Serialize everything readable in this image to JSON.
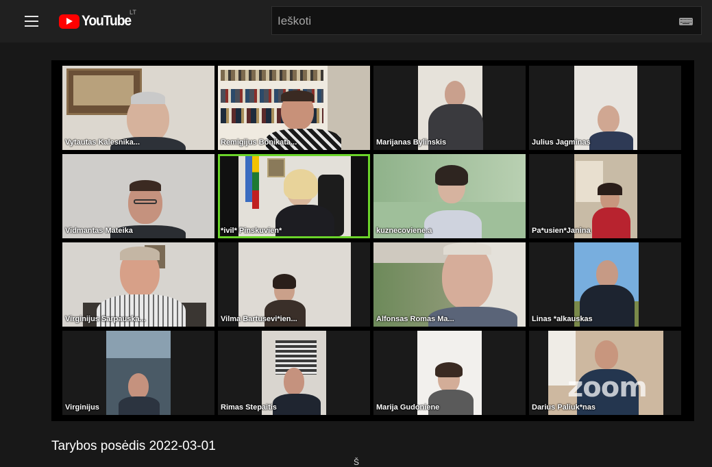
{
  "header": {
    "logo_text": "YouTube",
    "country_code": "LT",
    "search_placeholder": "Ieškoti"
  },
  "participants": [
    {
      "name": "Vytautas Kalesnika..."
    },
    {
      "name": "Remigijus Bonikata..."
    },
    {
      "name": "Marijanas Bylinskis"
    },
    {
      "name": "Julius Jagminas"
    },
    {
      "name": "Vidmantas Mateika"
    },
    {
      "name": "*ivil* Pinskuvien*"
    },
    {
      "name": "kuznecoviene.a"
    },
    {
      "name": "Pa*usien*Janina"
    },
    {
      "name": "Virginijus Sarpauska..."
    },
    {
      "name": "Vilma Bartusevi*ien..."
    },
    {
      "name": "Alfonsas Romas Ma..."
    },
    {
      "name": "Linas *alkauskas"
    },
    {
      "name": "Virginijus"
    },
    {
      "name": "Rimas Stepaitis"
    },
    {
      "name": "Marija Gudoniene"
    },
    {
      "name": "Darius Paliuk*nas"
    }
  ],
  "video": {
    "watermark": "zoom",
    "title": "Tarybos posėdis 2022-03-01",
    "clipped_text_below": "Š"
  },
  "colors": {
    "active_speaker_border": "#6bd42a",
    "brand_red": "#ff0000"
  }
}
